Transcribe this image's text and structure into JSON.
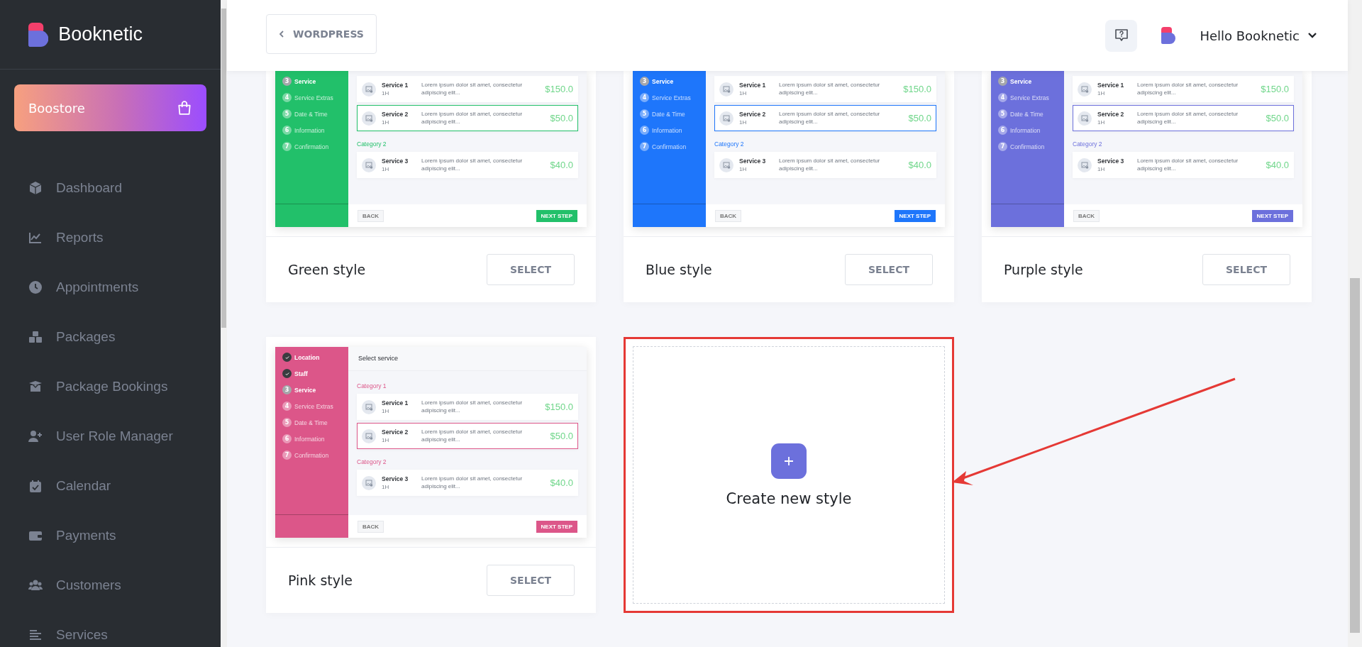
{
  "sidebar": {
    "brand": "Booknetic",
    "store_button": "Boostore",
    "items": [
      {
        "label": "Dashboard"
      },
      {
        "label": "Reports"
      },
      {
        "label": "Appointments"
      },
      {
        "label": "Packages"
      },
      {
        "label": "Package Bookings"
      },
      {
        "label": "User Role Manager"
      },
      {
        "label": "Calendar"
      },
      {
        "label": "Payments"
      },
      {
        "label": "Customers"
      },
      {
        "label": "Services"
      }
    ]
  },
  "header": {
    "back_button": "WORDPRESS",
    "user_greeting": "Hello Booknetic"
  },
  "styles": [
    {
      "name": "Green style",
      "color": "#22c06a",
      "select_button": "SELECT",
      "preview": {
        "steps": [
          {
            "number": "3",
            "label": "Service",
            "done": false,
            "current": true
          },
          {
            "number": "4",
            "label": "Service Extras",
            "done": false,
            "current": false
          },
          {
            "number": "5",
            "label": "Date & Time",
            "done": false,
            "current": false
          },
          {
            "number": "6",
            "label": "Information",
            "done": false,
            "current": false
          },
          {
            "number": "7",
            "label": "Confirmation",
            "done": false,
            "current": false
          }
        ],
        "categories": [
          {
            "services": [
              {
                "name": "Service 1",
                "duration": "1H",
                "description": "Lorem ipsum dolor sit amet, consectetur adipiscing elit...",
                "price": "$150.0",
                "selected": false
              },
              {
                "name": "Service 2",
                "duration": "1H",
                "description": "Lorem ipsum dolor sit amet, consectetur adipiscing elit...",
                "price": "$50.0",
                "selected": true
              }
            ]
          },
          {
            "label": "Category 2",
            "services": [
              {
                "name": "Service 3",
                "duration": "1H",
                "description": "Lorem ipsum dolor sit amet, consectetur adipiscing elit...",
                "price": "$40.0",
                "selected": false
              }
            ]
          }
        ],
        "back_button": "BACK",
        "next_button": "NEXT STEP"
      }
    },
    {
      "name": "Blue style",
      "color": "#1e76fb",
      "select_button": "SELECT",
      "preview": {
        "steps": [
          {
            "number": "3",
            "label": "Service",
            "done": false,
            "current": true
          },
          {
            "number": "4",
            "label": "Service Extras",
            "done": false,
            "current": false
          },
          {
            "number": "5",
            "label": "Date & Time",
            "done": false,
            "current": false
          },
          {
            "number": "6",
            "label": "Information",
            "done": false,
            "current": false
          },
          {
            "number": "7",
            "label": "Confirmation",
            "done": false,
            "current": false
          }
        ],
        "categories": [
          {
            "services": [
              {
                "name": "Service 1",
                "duration": "1H",
                "description": "Lorem ipsum dolor sit amet, consectetur adipiscing elit...",
                "price": "$150.0",
                "selected": false
              },
              {
                "name": "Service 2",
                "duration": "1H",
                "description": "Lorem ipsum dolor sit amet, consectetur adipiscing elit...",
                "price": "$50.0",
                "selected": true
              }
            ]
          },
          {
            "label": "Category 2",
            "services": [
              {
                "name": "Service 3",
                "duration": "1H",
                "description": "Lorem ipsum dolor sit amet, consectetur adipiscing elit...",
                "price": "$40.0",
                "selected": false
              }
            ]
          }
        ],
        "back_button": "BACK",
        "next_button": "NEXT STEP"
      }
    },
    {
      "name": "Purple style",
      "color": "#6c70dc",
      "select_button": "SELECT",
      "preview": {
        "steps": [
          {
            "number": "3",
            "label": "Service",
            "done": false,
            "current": true
          },
          {
            "number": "4",
            "label": "Service Extras",
            "done": false,
            "current": false
          },
          {
            "number": "5",
            "label": "Date & Time",
            "done": false,
            "current": false
          },
          {
            "number": "6",
            "label": "Information",
            "done": false,
            "current": false
          },
          {
            "number": "7",
            "label": "Confirmation",
            "done": false,
            "current": false
          }
        ],
        "categories": [
          {
            "services": [
              {
                "name": "Service 1",
                "duration": "1H",
                "description": "Lorem ipsum dolor sit amet, consectetur adipiscing elit...",
                "price": "$150.0",
                "selected": false
              },
              {
                "name": "Service 2",
                "duration": "1H",
                "description": "Lorem ipsum dolor sit amet, consectetur adipiscing elit...",
                "price": "$50.0",
                "selected": true
              }
            ]
          },
          {
            "label": "Category 2",
            "services": [
              {
                "name": "Service 3",
                "duration": "1H",
                "description": "Lorem ipsum dolor sit amet, consectetur adipiscing elit...",
                "price": "$40.0",
                "selected": false
              }
            ]
          }
        ],
        "back_button": "BACK",
        "next_button": "NEXT STEP"
      }
    },
    {
      "name": "Pink style",
      "color": "#dc5689",
      "select_button": "SELECT",
      "preview": {
        "heading": "Select service",
        "steps": [
          {
            "label": "Location",
            "done": true,
            "current": false
          },
          {
            "label": "Staff",
            "done": true,
            "current": false
          },
          {
            "number": "3",
            "label": "Service",
            "done": false,
            "current": true
          },
          {
            "number": "4",
            "label": "Service Extras",
            "done": false,
            "current": false
          },
          {
            "number": "5",
            "label": "Date & Time",
            "done": false,
            "current": false
          },
          {
            "number": "6",
            "label": "Information",
            "done": false,
            "current": false
          },
          {
            "number": "7",
            "label": "Confirmation",
            "done": false,
            "current": false
          }
        ],
        "categories": [
          {
            "label": "Category 1",
            "services": [
              {
                "name": "Service 1",
                "duration": "1H",
                "description": "Lorem ipsum dolor sit amet, consectetur adipiscing elit...",
                "price": "$150.0",
                "selected": false
              },
              {
                "name": "Service 2",
                "duration": "1H",
                "description": "Lorem ipsum dolor sit amet, consectetur adipiscing elit...",
                "price": "$50.0",
                "selected": true
              }
            ]
          },
          {
            "label": "Category 2",
            "services": [
              {
                "name": "Service 3",
                "duration": "1H",
                "description": "Lorem ipsum dolor sit amet, consectetur adipiscing elit...",
                "price": "$40.0",
                "selected": false
              }
            ]
          }
        ],
        "back_button": "BACK",
        "next_button": "NEXT STEP"
      }
    }
  ],
  "create_card": {
    "label": "Create new style",
    "highlighted": true
  },
  "annotation_arrow": true
}
